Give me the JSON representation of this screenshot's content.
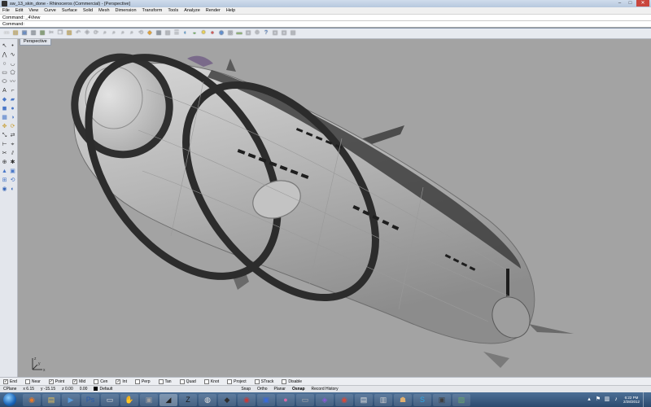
{
  "window": {
    "title": "sw_13_skin_done - Rhinoceros (Commercial) - [Perspective]",
    "min": "–",
    "max": "□",
    "close": "✕"
  },
  "menu": [
    "File",
    "Edit",
    "View",
    "Curve",
    "Surface",
    "Solid",
    "Mesh",
    "Dimension",
    "Transform",
    "Tools",
    "Analyze",
    "Render",
    "Help"
  ],
  "command": {
    "history": "Command: _4View",
    "prompt": "Command:",
    "value": ""
  },
  "toolbar_icons": [
    {
      "name": "new-icon",
      "glyph": "▭",
      "color": "#ffffff"
    },
    {
      "name": "open-icon",
      "glyph": "▤",
      "color": "#e8c25a"
    },
    {
      "name": "save-icon",
      "glyph": "▣",
      "color": "#6a8fc8"
    },
    {
      "name": "print-icon",
      "glyph": "▥",
      "color": "#9aa4b0"
    },
    {
      "name": "import-icon",
      "glyph": "▦",
      "color": "#8fb07a"
    },
    {
      "name": "cut-icon",
      "glyph": "✂",
      "color": "#c8cbd2"
    },
    {
      "name": "copy-icon",
      "glyph": "❐",
      "color": "#c8cbd2"
    },
    {
      "name": "paste-icon",
      "glyph": "▨",
      "color": "#e8c25a"
    },
    {
      "name": "undo-icon",
      "glyph": "↶",
      "color": "#c8cbd2"
    },
    {
      "name": "pan-icon",
      "glyph": "✥",
      "color": "#c8cbd2"
    },
    {
      "name": "rotate-view-icon",
      "glyph": "⟳",
      "color": "#c8cbd2"
    },
    {
      "name": "zoom-icon",
      "glyph": "⌕",
      "color": "#c8cbd2"
    },
    {
      "name": "zoom-window-icon",
      "glyph": "⌕",
      "color": "#c8cbd2"
    },
    {
      "name": "zoom-extents-icon",
      "glyph": "⌕",
      "color": "#c8cbd2"
    },
    {
      "name": "zoom-selected-icon",
      "glyph": "⌕",
      "color": "#c8cbd2"
    },
    {
      "name": "undo-view-icon",
      "glyph": "⟲",
      "color": "#c8cbd2"
    },
    {
      "name": "select-icon",
      "glyph": "◆",
      "color": "#e0a13a"
    },
    {
      "name": "grid-icon",
      "glyph": "▦",
      "color": "#9aa4b0"
    },
    {
      "name": "layers-icon",
      "glyph": "▤",
      "color": "#c8cbd2"
    },
    {
      "name": "properties-icon",
      "glyph": "☰",
      "color": "#c8cbd2"
    },
    {
      "name": "shade-icon",
      "glyph": "◐",
      "color": "#5aa1d8"
    },
    {
      "name": "render-icon",
      "glyph": "◒",
      "color": "#6ab05a"
    },
    {
      "name": "light-icon",
      "glyph": "✹",
      "color": "#e8d05a"
    },
    {
      "name": "material-icon",
      "glyph": "●",
      "color": "#d05a5a"
    },
    {
      "name": "environment-icon",
      "glyph": "◉",
      "color": "#5a8fd8"
    },
    {
      "name": "texture-icon",
      "glyph": "▩",
      "color": "#c8cbd2"
    },
    {
      "name": "ground-icon",
      "glyph": "▬",
      "color": "#8fb07a"
    },
    {
      "name": "rebuild-icon",
      "glyph": "▣",
      "color": "#c8cbd2"
    },
    {
      "name": "options-icon",
      "glyph": "⚙",
      "color": "#c8cbd2"
    },
    {
      "name": "help-icon",
      "glyph": "?",
      "color": "#5a8fd8"
    },
    {
      "name": "tool-a-icon",
      "glyph": "▣",
      "color": "#c8cbd2"
    },
    {
      "name": "tool-b-icon",
      "glyph": "▣",
      "color": "#c8cbd2"
    },
    {
      "name": "tool-c-icon",
      "glyph": "▤",
      "color": "#c8cbd2"
    }
  ],
  "left_tools": [
    {
      "name": "select-arrow-icon",
      "glyph": "↖",
      "color": "#333333"
    },
    {
      "name": "point-icon",
      "glyph": "•",
      "color": "#333333"
    },
    {
      "name": "polyline-icon",
      "glyph": "⋀",
      "color": "#333333"
    },
    {
      "name": "curve-icon",
      "glyph": "∿",
      "color": "#333333"
    },
    {
      "name": "circle-icon",
      "glyph": "○",
      "color": "#333333"
    },
    {
      "name": "arc-icon",
      "glyph": "◡",
      "color": "#333333"
    },
    {
      "name": "rectangle-icon",
      "glyph": "▭",
      "color": "#333333"
    },
    {
      "name": "polygon-icon",
      "glyph": "⬠",
      "color": "#333333"
    },
    {
      "name": "ellipse-icon",
      "glyph": "⬭",
      "color": "#333333"
    },
    {
      "name": "free-form-icon",
      "glyph": "〰",
      "color": "#333333"
    },
    {
      "name": "text-icon",
      "glyph": "A",
      "color": "#333333"
    },
    {
      "name": "fillet-icon",
      "glyph": "⌐",
      "color": "#333333"
    },
    {
      "name": "surface-icon",
      "glyph": "◆",
      "color": "#4a78c8"
    },
    {
      "name": "extrude-icon",
      "glyph": "▰",
      "color": "#4a78c8"
    },
    {
      "name": "box-icon",
      "glyph": "◼",
      "color": "#4a78c8"
    },
    {
      "name": "sphere-icon",
      "glyph": "●",
      "color": "#4a78c8"
    },
    {
      "name": "mesh-icon",
      "glyph": "▦",
      "color": "#4a78c8"
    },
    {
      "name": "boolean-icon",
      "glyph": "◑",
      "color": "#4a78c8"
    },
    {
      "name": "transform-icon",
      "glyph": "✥",
      "color": "#c8a03a"
    },
    {
      "name": "rotate-icon",
      "glyph": "⟳",
      "color": "#c8a03a"
    },
    {
      "name": "scale-icon",
      "glyph": "⤡",
      "color": "#333333"
    },
    {
      "name": "mirror-icon",
      "glyph": "⇄",
      "color": "#333333"
    },
    {
      "name": "dimension-icon",
      "glyph": "⊢",
      "color": "#333333"
    },
    {
      "name": "analyze-icon",
      "glyph": "⌖",
      "color": "#333333"
    },
    {
      "name": "trim-icon",
      "glyph": "✂",
      "color": "#333333"
    },
    {
      "name": "split-icon",
      "glyph": "⫽",
      "color": "#333333"
    },
    {
      "name": "join-icon",
      "glyph": "⊕",
      "color": "#333333"
    },
    {
      "name": "explode-icon",
      "glyph": "✱",
      "color": "#333333"
    },
    {
      "name": "lock-icon",
      "glyph": "▲",
      "color": "#4a78c8"
    },
    {
      "name": "group-icon",
      "glyph": "▣",
      "color": "#4a78c8"
    },
    {
      "name": "array-icon",
      "glyph": "⊞",
      "color": "#4a78c8"
    },
    {
      "name": "history-icon",
      "glyph": "⟲",
      "color": "#4a78c8"
    },
    {
      "name": "render-tool-icon",
      "glyph": "◉",
      "color": "#3a68b8"
    },
    {
      "name": "material-tool-icon",
      "glyph": "◐",
      "color": "#3a68b8"
    }
  ],
  "viewport": {
    "label": "Perspective",
    "background": "#a3a3a3",
    "axis_x": "x",
    "axis_y": "y",
    "axis_z": "z"
  },
  "osnaps": [
    {
      "label": "End",
      "checked": true
    },
    {
      "label": "Near",
      "checked": false
    },
    {
      "label": "Point",
      "checked": true
    },
    {
      "label": "Mid",
      "checked": true
    },
    {
      "label": "Cen",
      "checked": false
    },
    {
      "label": "Int",
      "checked": true
    },
    {
      "label": "Perp",
      "checked": false
    },
    {
      "label": "Tan",
      "checked": false
    },
    {
      "label": "Quad",
      "checked": false
    },
    {
      "label": "Knot",
      "checked": false
    },
    {
      "label": "Project",
      "checked": false
    },
    {
      "label": "STrack",
      "checked": false
    },
    {
      "label": "Disable",
      "checked": false
    }
  ],
  "status": {
    "cplane": "CPlane",
    "x": "x 6.15",
    "y": "y -15.15",
    "z": "z 0.00",
    "dist": "0.00",
    "layer": "Default",
    "snap": "Snap",
    "ortho": "Ortho",
    "planar": "Planar",
    "osnap": "Osnap",
    "record": "Record History"
  },
  "taskbar": {
    "apps": [
      {
        "name": "firefox-icon",
        "glyph": "◉",
        "color": "#e87a2a"
      },
      {
        "name": "folder-icon",
        "glyph": "▤",
        "color": "#e8c25a"
      },
      {
        "name": "media-icon",
        "glyph": "▶",
        "color": "#5a9ad8"
      },
      {
        "name": "photoshop-icon",
        "glyph": "Ps",
        "color": "#2a5aa8"
      },
      {
        "name": "app-white-icon",
        "glyph": "▭",
        "color": "#e0e0e0"
      },
      {
        "name": "hand-icon",
        "glyph": "✋",
        "color": "#e8a8a8"
      },
      {
        "name": "app-gray-icon",
        "glyph": "▣",
        "color": "#a0a0a0"
      },
      {
        "name": "rhino-icon",
        "glyph": "◢",
        "color": "#222222"
      },
      {
        "name": "zbrush-icon",
        "glyph": "Z",
        "color": "#1a1a1a"
      },
      {
        "name": "app-swirl-icon",
        "glyph": "◍",
        "color": "#e0e0e0"
      },
      {
        "name": "app-dark-icon",
        "glyph": "◆",
        "color": "#303030"
      },
      {
        "name": "app-red-icon",
        "glyph": "◉",
        "color": "#c83a3a"
      },
      {
        "name": "app-blue-icon",
        "glyph": "▣",
        "color": "#3a6ad8"
      },
      {
        "name": "app-pink-icon",
        "glyph": "●",
        "color": "#d86aa8"
      },
      {
        "name": "app-gray2-icon",
        "glyph": "▭",
        "color": "#b0b0b0"
      },
      {
        "name": "app-purple-icon",
        "glyph": "◈",
        "color": "#8a5ad8"
      },
      {
        "name": "app-red2-icon",
        "glyph": "◉",
        "color": "#d84a3a"
      },
      {
        "name": "app-doc-icon",
        "glyph": "▤",
        "color": "#e0e0e0"
      },
      {
        "name": "app-doc2-icon",
        "glyph": "▥",
        "color": "#d0d0d0"
      },
      {
        "name": "app-hands-icon",
        "glyph": "☗",
        "color": "#e0b070"
      },
      {
        "name": "skype-icon",
        "glyph": "S",
        "color": "#2aa8e8"
      },
      {
        "name": "app-dark2-icon",
        "glyph": "▣",
        "color": "#404040"
      },
      {
        "name": "app-photo-icon",
        "glyph": "▨",
        "color": "#6aa86a"
      }
    ],
    "active_app": "rhino-icon",
    "tray": [
      {
        "name": "tray-arrow-icon",
        "glyph": "▴"
      },
      {
        "name": "tray-flag-icon",
        "glyph": "⚑"
      },
      {
        "name": "tray-network-icon",
        "glyph": "▥"
      },
      {
        "name": "tray-volume-icon",
        "glyph": "♪"
      }
    ],
    "time": "6:22 PM",
    "date": "2/28/2012"
  }
}
